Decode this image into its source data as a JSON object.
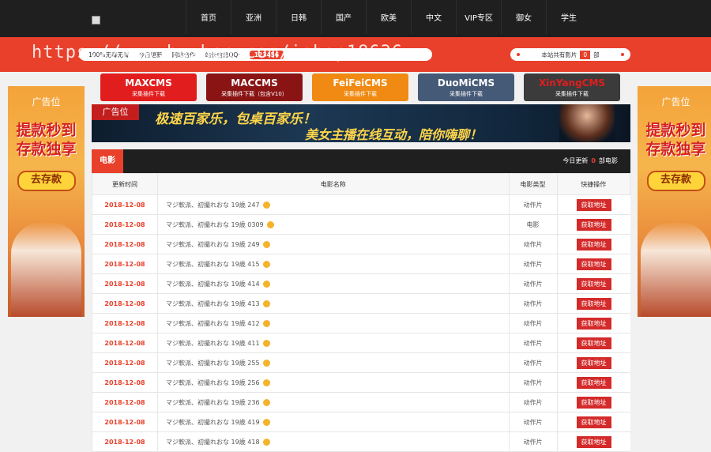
{
  "header": {
    "nav": [
      "首页",
      "亚洲",
      "日韩",
      "国产",
      "欧美",
      "中文",
      "VIP专区",
      "御女",
      "学生"
    ]
  },
  "infobar": {
    "left_items": [
      "100%无毒无毒",
      "今日更新",
      "网站合作",
      "站长信息QQ:"
    ],
    "qq": "123456",
    "right_label": "本站共有影片",
    "right_count": "0",
    "right_unit": "部"
  },
  "watermark": "https://www.huzhan.com/ishop18636",
  "side_ads": {
    "label": "广告位",
    "headline_line1": "提款秒到",
    "headline_line2": "存款独享",
    "button": "去存款"
  },
  "cms_buttons": [
    {
      "name": "MAXCMS",
      "sub": "采集插件下载",
      "color": "#e21d1d"
    },
    {
      "name": "MACCMS",
      "sub": "采集插件下载（包含V10）",
      "color": "#8a1414"
    },
    {
      "name": "FeiFeiCMS",
      "sub": "采集插件下载",
      "color": "#f08a12"
    },
    {
      "name": "DuoMiCMS",
      "sub": "采集插件下载",
      "color": "#455a77"
    },
    {
      "name": "XinYangCMS",
      "sub": "采集插件下载",
      "color": "#3b3b3b"
    }
  ],
  "banner": {
    "tag": "广告位",
    "line1": "极速百家乐，包桌百家乐！",
    "line2": "美女主播在线互动，陪你嗨聊！"
  },
  "section": {
    "title": "电影",
    "today_label": "今日更新",
    "today_count": "0",
    "today_unit": "部电影"
  },
  "table": {
    "headers": [
      "更新时间",
      "电影名称",
      "电影类型",
      "快捷操作"
    ],
    "action_label": "获取地址",
    "rows": [
      {
        "date": "2018-12-08",
        "name": "マジ軟派、初撮れおな 19歳 247",
        "type": "动作片"
      },
      {
        "date": "2018-12-08",
        "name": "マジ軟派、初撮れおな 19歳 0309",
        "type": "电影"
      },
      {
        "date": "2018-12-08",
        "name": "マジ軟派、初撮れおな 19歳 249",
        "type": "动作片"
      },
      {
        "date": "2018-12-08",
        "name": "マジ軟派、初撮れおな 19歳 415",
        "type": "动作片"
      },
      {
        "date": "2018-12-08",
        "name": "マジ軟派、初撮れおな 19歳 414",
        "type": "动作片"
      },
      {
        "date": "2018-12-08",
        "name": "マジ軟派、初撮れおな 19歳 413",
        "type": "动作片"
      },
      {
        "date": "2018-12-08",
        "name": "マジ軟派、初撮れおな 19歳 412",
        "type": "动作片"
      },
      {
        "date": "2018-12-08",
        "name": "マジ軟派、初撮れおな 19歳 411",
        "type": "动作片"
      },
      {
        "date": "2018-12-08",
        "name": "マジ軟派、初撮れおな 19歳 255",
        "type": "动作片"
      },
      {
        "date": "2018-12-08",
        "name": "マジ軟派、初撮れおな 19歳 256",
        "type": "动作片"
      },
      {
        "date": "2018-12-08",
        "name": "マジ軟派、初撮れおな 19歳 236",
        "type": "动作片"
      },
      {
        "date": "2018-12-08",
        "name": "マジ軟派、初撮れおな 19歳 419",
        "type": "动作片"
      },
      {
        "date": "2018-12-08",
        "name": "マジ軟派、初撮れおな 19歳 418",
        "type": "动作片"
      }
    ]
  }
}
